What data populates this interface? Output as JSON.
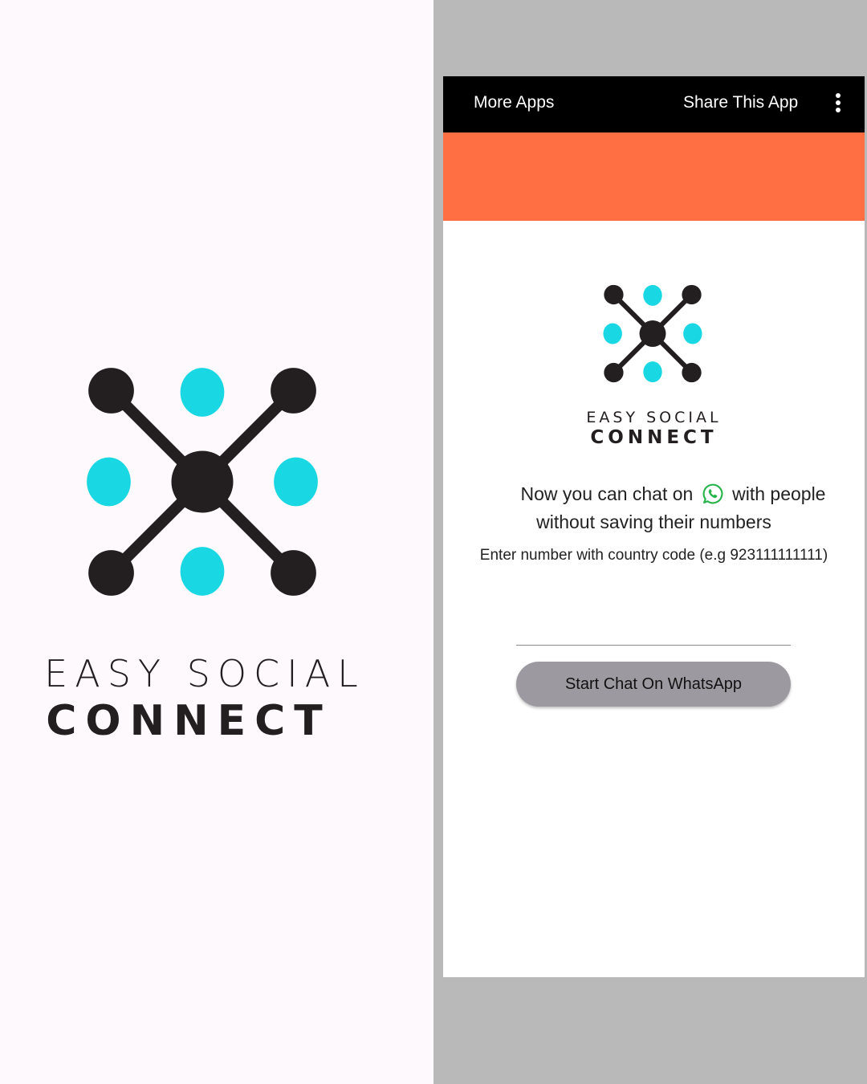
{
  "splash": {
    "logo_line1": "EASY SOCIAL",
    "logo_line2": "CONNECT"
  },
  "appbar": {
    "more_apps": "More Apps",
    "share_app": "Share This App",
    "overflow_icon": "more-vert-icon"
  },
  "banner": {
    "color": "#ff6f43"
  },
  "logo": {
    "line1": "EASY SOCIAL",
    "line2": "CONNECT",
    "dark_color": "#231f20",
    "accent_color": "#1ad8e3"
  },
  "main": {
    "tagline_part1": "Now you can chat on",
    "tagline_icon": "whatsapp-icon",
    "tagline_part2": "with people",
    "tagline_part3": "without saving their numbers",
    "instruction": "Enter number with country code (e.g 923111111111)",
    "number_value": "",
    "start_button": "Start Chat On WhatsApp"
  }
}
